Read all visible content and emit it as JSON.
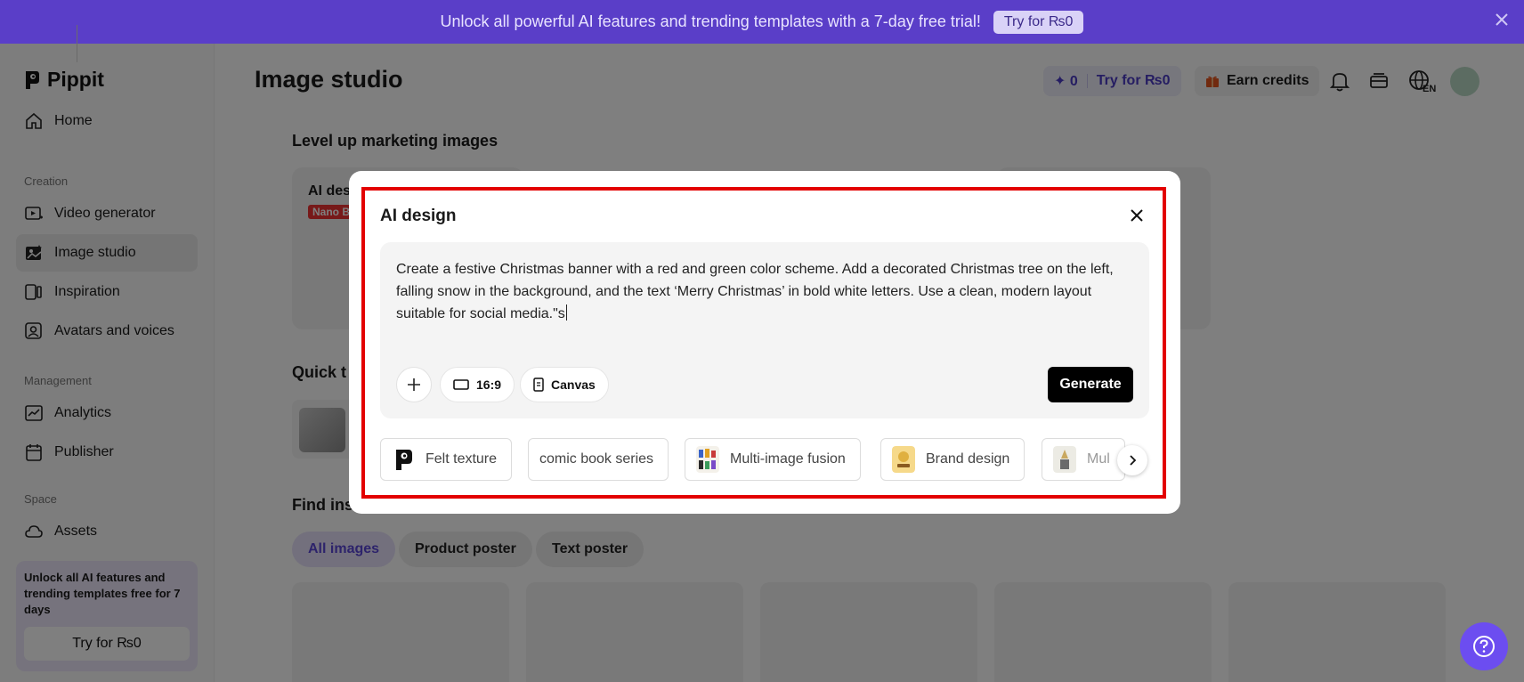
{
  "banner": {
    "message": "Unlock all powerful AI features and trending templates with a 7-day free trial!",
    "cta": "Try for ₨0"
  },
  "sidebar": {
    "logo": "Pippit",
    "nav": [
      {
        "label": "Home",
        "icon": "home-icon"
      },
      {
        "label": "Video generator",
        "icon": "video-icon"
      },
      {
        "label": "Image studio",
        "icon": "image-icon",
        "active": true
      },
      {
        "label": "Inspiration",
        "icon": "inspiration-icon"
      },
      {
        "label": "Avatars and voices",
        "icon": "avatar-icon"
      },
      {
        "label": "Analytics",
        "icon": "analytics-icon"
      },
      {
        "label": "Publisher",
        "icon": "calendar-icon"
      },
      {
        "label": "Assets",
        "icon": "cloud-icon"
      }
    ],
    "sections": [
      "Creation",
      "Management",
      "Space"
    ],
    "promo": {
      "text": "Unlock all AI features and trending templates free for 7 days",
      "button": "Try for ₨0"
    }
  },
  "header": {
    "title": "Image studio",
    "credits": "0",
    "try_label": "Try for ₨0",
    "earn_label": "Earn credits",
    "lang": "EN"
  },
  "main": {
    "section_marketing": "Level up marketing images",
    "card_title_partial": "AI des",
    "card_badge_partial": "Nano B",
    "section_quick_partial": "Quick t",
    "section_find_partial": "Find ins",
    "tabs": [
      "All images",
      "Product poster",
      "Text poster"
    ]
  },
  "modal": {
    "title": "AI design",
    "prompt": "Create a festive Christmas banner with a red and green color scheme. Add a decorated Christmas tree on the left, falling snow in the background, and the text ‘Merry Christmas’ in bold white letters. Use a clean, modern layout suitable for social media.\"s",
    "ratio": "16:9",
    "canvas": "Canvas",
    "generate": "Generate",
    "styles": [
      "Felt texture",
      "comic book series",
      "Multi-image fusion",
      "Brand design",
      "Mul"
    ]
  },
  "colors": {
    "banner": "#5a3ec8",
    "accent": "#6c4df0",
    "highlight_frame": "#e30000"
  }
}
